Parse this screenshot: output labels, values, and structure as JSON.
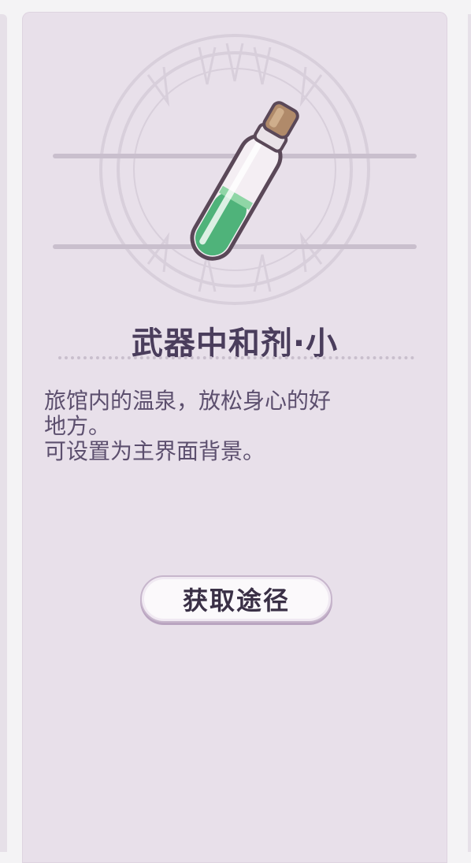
{
  "item": {
    "name": "武器中和剂·小",
    "description": [
      "旅馆内的温泉，放松身心的好",
      "地方。",
      "可设置为主界面背景。"
    ],
    "icon": "green-potion-vial-icon"
  },
  "actions": {
    "obtain_label": "获取途径"
  },
  "colors": {
    "card_bg": "#e8e0ea",
    "title": "#4a3d5c",
    "text": "#5c4f6e",
    "liquid": "#4fb37a"
  }
}
